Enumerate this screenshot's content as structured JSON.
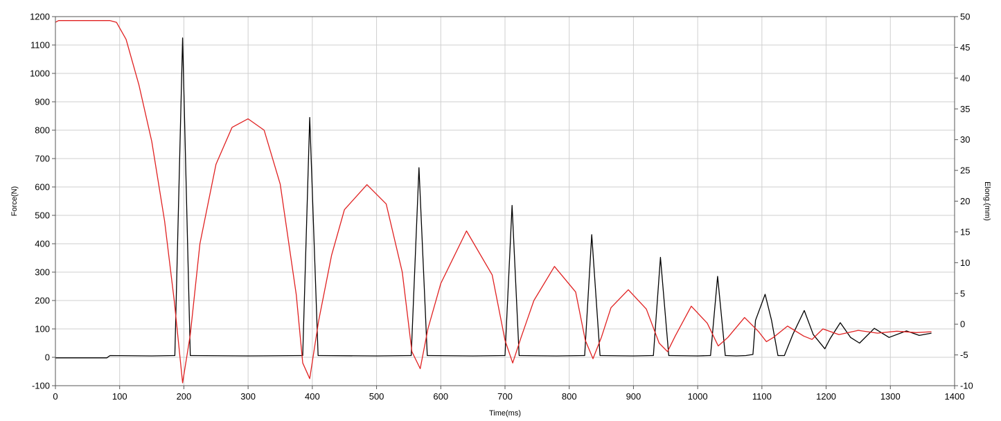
{
  "chart_data": {
    "type": "line",
    "xlabel": "Time(ms)",
    "ylabel_left": "Force(N)",
    "ylabel_right": "Elong.(mm)",
    "xlim": [
      0,
      1400
    ],
    "ylim_left": [
      -100,
      1200
    ],
    "ylim_right": [
      -10,
      50
    ],
    "x_ticks": [
      0,
      100,
      200,
      300,
      400,
      500,
      600,
      700,
      800,
      900,
      1000,
      1100,
      1200,
      1300,
      1400
    ],
    "y_left_ticks": [
      -100,
      0,
      100,
      200,
      300,
      400,
      500,
      600,
      700,
      800,
      900,
      1000,
      1100,
      1200
    ],
    "y_right_ticks": [
      -10,
      -5,
      0,
      5,
      10,
      15,
      20,
      25,
      30,
      35,
      40,
      45,
      50
    ],
    "grid": true,
    "series": [
      {
        "axis": "left",
        "color": "#000000",
        "x": [
          0,
          80,
          85,
          150,
          184,
          186,
          198,
          210,
          212,
          300,
          383,
          385,
          396,
          409,
          411,
          500,
          552,
          554,
          566,
          579,
          581,
          650,
          698,
          700,
          711,
          722,
          724,
          780,
          822,
          824,
          835,
          848,
          850,
          900,
          929,
          931,
          942,
          955,
          957,
          1000,
          1018,
          1020,
          1031,
          1043,
          1045,
          1060,
          1075,
          1086,
          1090,
          1105,
          1115,
          1125,
          1135,
          1148,
          1166,
          1180,
          1198,
          1206,
          1222,
          1238,
          1252,
          1275,
          1298,
          1325,
          1345,
          1364
        ],
        "values": [
          -2,
          -2,
          6,
          5,
          6,
          6,
          1125,
          6,
          6,
          5,
          6,
          6,
          845,
          6,
          6,
          5,
          6,
          6,
          668,
          6,
          6,
          5,
          6,
          6,
          535,
          6,
          6,
          5,
          6,
          6,
          432,
          6,
          6,
          5,
          6,
          6,
          352,
          6,
          6,
          5,
          6,
          6,
          285,
          6,
          6,
          5,
          6,
          10,
          130,
          222,
          130,
          6,
          6,
          80,
          165,
          80,
          30,
          65,
          122,
          70,
          50,
          102,
          70,
          93,
          77,
          85
        ]
      },
      {
        "axis": "left",
        "color": "#e02020",
        "x": [
          0,
          5,
          85,
          95,
          110,
          130,
          150,
          170,
          185,
          198,
          210,
          225,
          250,
          275,
          300,
          325,
          350,
          375,
          385,
          396,
          410,
          430,
          450,
          485,
          515,
          540,
          555,
          568,
          580,
          600,
          640,
          680,
          700,
          712,
          725,
          745,
          777,
          810,
          825,
          837,
          850,
          865,
          892,
          920,
          940,
          953,
          965,
          990,
          1015,
          1032,
          1047,
          1073,
          1095,
          1107,
          1118,
          1140,
          1165,
          1178,
          1195,
          1220,
          1250,
          1280,
          1310,
          1340,
          1364
        ],
        "values": [
          1180,
          1186,
          1186,
          1180,
          1120,
          960,
          760,
          480,
          200,
          -90,
          80,
          400,
          680,
          810,
          840,
          800,
          610,
          220,
          -20,
          -75,
          130,
          360,
          520,
          608,
          540,
          300,
          20,
          -40,
          100,
          260,
          445,
          290,
          60,
          -20,
          70,
          200,
          320,
          230,
          60,
          -5,
          70,
          175,
          238,
          170,
          50,
          20,
          75,
          180,
          120,
          40,
          70,
          140,
          90,
          55,
          70,
          110,
          75,
          63,
          100,
          80,
          95,
          85,
          92,
          87,
          90
        ]
      }
    ]
  }
}
